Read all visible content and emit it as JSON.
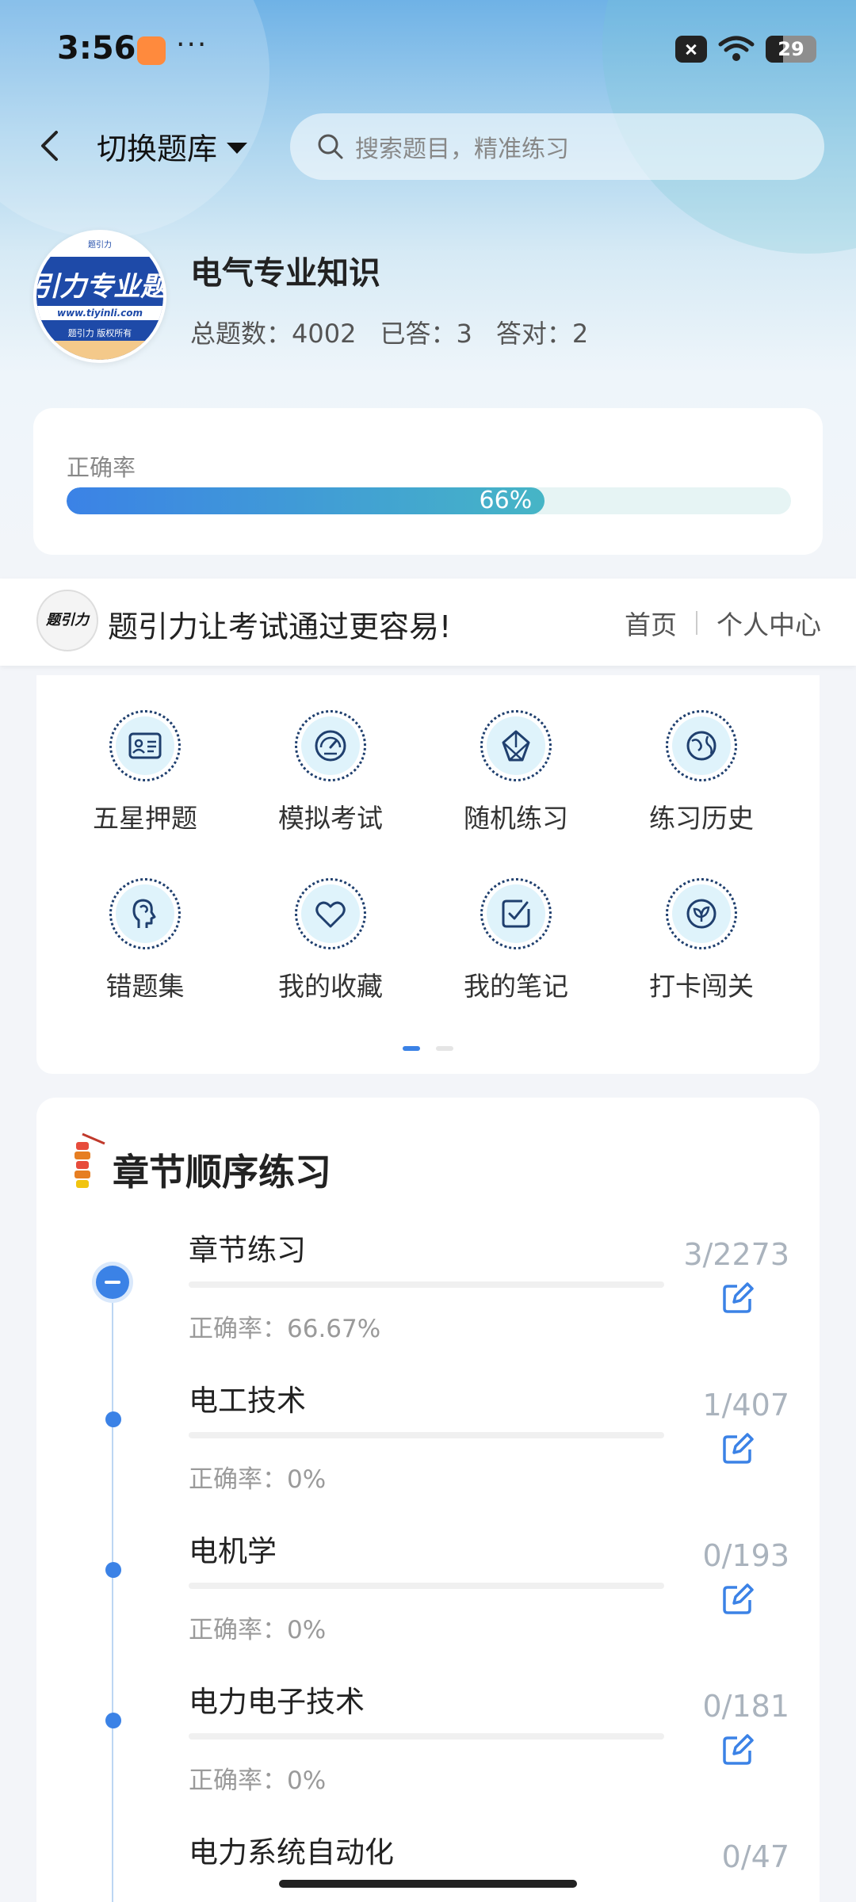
{
  "status_bar": {
    "time": "3:56",
    "more": "···",
    "battery": "29"
  },
  "nav": {
    "bank_switch_label": "切换题库",
    "search_placeholder": "搜索题目，精准练习"
  },
  "profile": {
    "logo_top_text": "题引力",
    "logo_band_text": "引力专业题",
    "logo_url": "www.tiyinli.com",
    "logo_bottom_text": "题引力 版权所有",
    "title": "电气专业知识",
    "stats": {
      "total": "总题数：4002",
      "answered": "已答：3",
      "correct": "答对：2"
    }
  },
  "accuracy": {
    "label": "正确率",
    "value_text": "66%",
    "value": 0.66
  },
  "banner": {
    "logo_mark": "题引力",
    "text": "题引力让考试通过更容易!",
    "link_home": "首页",
    "link_personal": "个人中心"
  },
  "functions": [
    {
      "label": "五星押题",
      "icon": "id-card-icon"
    },
    {
      "label": "模拟考试",
      "icon": "gauge-icon"
    },
    {
      "label": "随机练习",
      "icon": "shuffle-icon"
    },
    {
      "label": "练习历史",
      "icon": "globe-icon"
    },
    {
      "label": "错题集",
      "icon": "brain-icon"
    },
    {
      "label": "我的收藏",
      "icon": "heart-icon"
    },
    {
      "label": "我的笔记",
      "icon": "note-check-icon"
    },
    {
      "label": "打卡闯关",
      "icon": "leaf-badge-icon"
    }
  ],
  "pager": {
    "pages": 2,
    "active": 0
  },
  "chapters": {
    "title": "章节顺序练习",
    "items": [
      {
        "name": "章节练习",
        "accuracy": "正确率：66.67%",
        "count": "3/2273"
      },
      {
        "name": "电工技术",
        "accuracy": "正确率：0%",
        "count": "1/407"
      },
      {
        "name": "电机学",
        "accuracy": "正确率：0%",
        "count": "0/193"
      },
      {
        "name": "电力电子技术",
        "accuracy": "正确率：0%",
        "count": "0/181"
      },
      {
        "name": "电力系统自动化",
        "accuracy": "",
        "count": "0/47"
      }
    ]
  },
  "colors": {
    "accent": "#3b82e6",
    "teal": "#46b5c6",
    "dark_icon": "#1f3f6e"
  }
}
